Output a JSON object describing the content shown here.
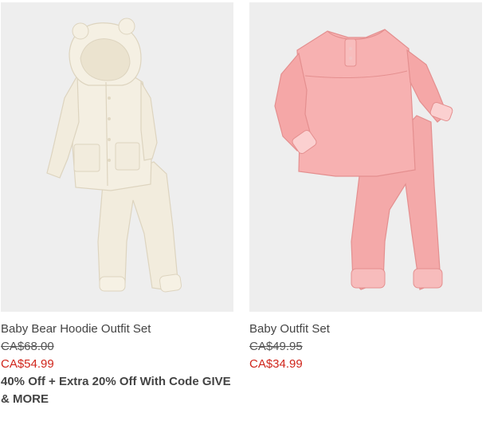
{
  "products": [
    {
      "name": "Baby Bear Hoodie Outfit Set",
      "original_price": "CA$68.00",
      "sale_price": "CA$54.99",
      "promo": "40% Off + Extra 20% Off With Code GIVE & MORE",
      "image_icon": "bear-hoodie-outfit-image",
      "garment_color": "#f3eee0"
    },
    {
      "name": "Baby Outfit Set",
      "original_price": "CA$49.95",
      "sale_price": "CA$34.99",
      "image_icon": "pink-outfit-image",
      "garment_color": "#f4a9a9"
    }
  ],
  "colors": {
    "sale_price": "#d0251b",
    "image_background": "#eeeeee"
  }
}
